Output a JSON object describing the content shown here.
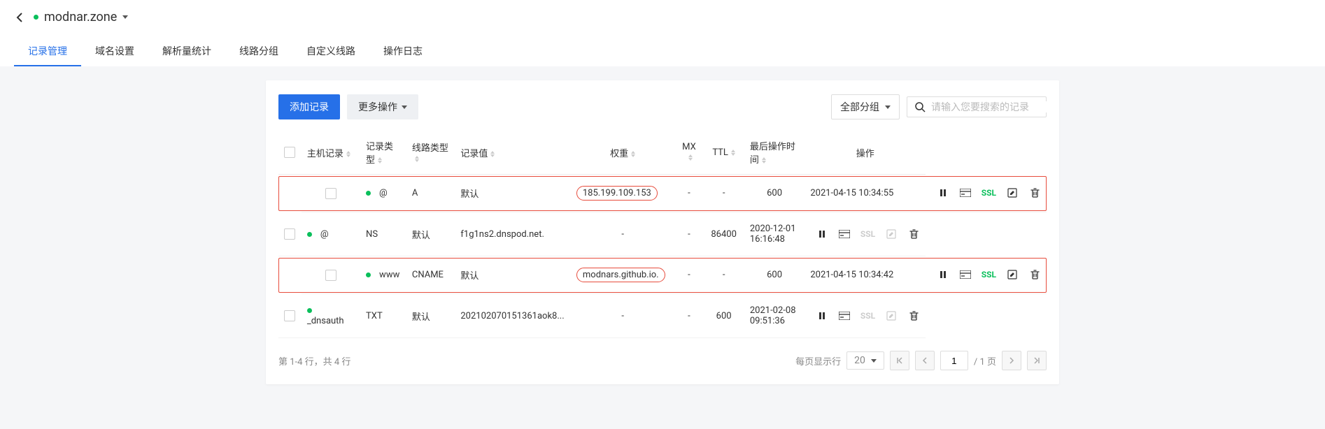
{
  "header": {
    "domain": "modnar.zone"
  },
  "tabs": [
    {
      "label": "记录管理",
      "active": true
    },
    {
      "label": "域名设置",
      "active": false
    },
    {
      "label": "解析量统计",
      "active": false
    },
    {
      "label": "线路分组",
      "active": false
    },
    {
      "label": "自定义线路",
      "active": false
    },
    {
      "label": "操作日志",
      "active": false
    }
  ],
  "toolbar": {
    "add_record": "添加记录",
    "more_ops": "更多操作",
    "group_select": "全部分组",
    "search_placeholder": "请输入您要搜索的记录"
  },
  "columns": {
    "host": "主机记录",
    "type": "记录类型",
    "line": "线路类型",
    "value": "记录值",
    "weight": "权重",
    "mx": "MX",
    "ttl": "TTL",
    "last_op": "最后操作时间",
    "actions": "操作"
  },
  "rows": [
    {
      "host": "@",
      "type": "A",
      "line": "默认",
      "value": "185.199.109.153",
      "weight": "-",
      "mx": "-",
      "ttl": "600",
      "time": "2021-04-15 10:34:55",
      "highlight": true,
      "value_oval": true,
      "ssl_active": true
    },
    {
      "host": "@",
      "type": "NS",
      "line": "默认",
      "value": "f1g1ns2.dnspod.net.",
      "weight": "-",
      "mx": "-",
      "ttl": "86400",
      "time": "2020-12-01 16:16:48",
      "highlight": false,
      "value_oval": false,
      "ssl_active": false
    },
    {
      "host": "www",
      "type": "CNAME",
      "line": "默认",
      "value": "modnars.github.io.",
      "weight": "-",
      "mx": "-",
      "ttl": "600",
      "time": "2021-04-15 10:34:42",
      "highlight": true,
      "value_oval": true,
      "ssl_active": true
    },
    {
      "host": "_dnsauth",
      "type": "TXT",
      "line": "默认",
      "value": "202102070151361aok8...",
      "weight": "-",
      "mx": "-",
      "ttl": "600",
      "time": "2021-02-08 09:51:36",
      "highlight": false,
      "value_oval": false,
      "ssl_active": false
    }
  ],
  "pagination": {
    "summary": "第 1-4 行，共 4 行",
    "per_page_label": "每页显示行",
    "per_page": "20",
    "page": "1",
    "total_pages_suffix": "/ 1 页"
  }
}
